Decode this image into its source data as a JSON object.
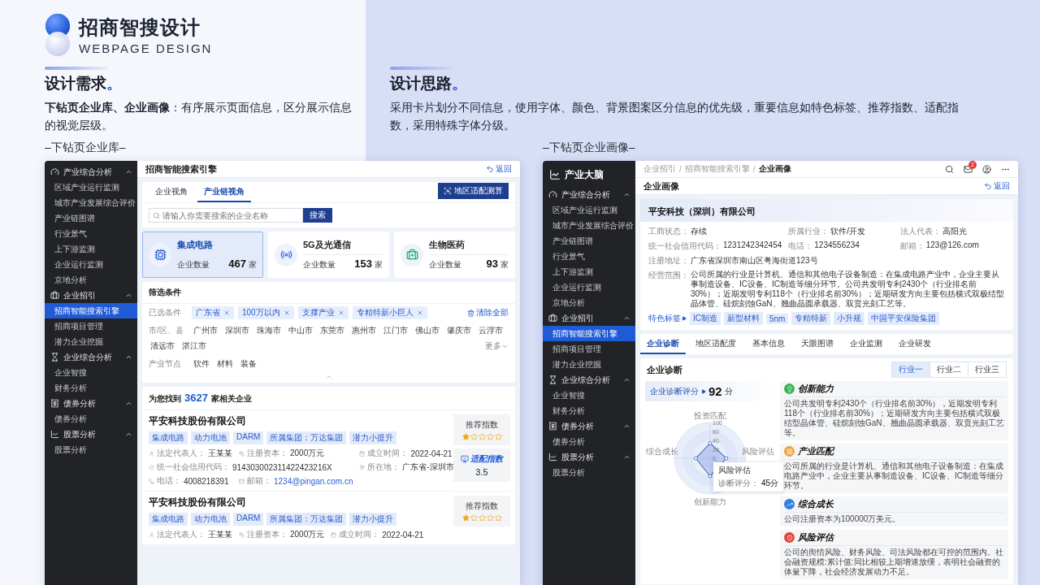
{
  "brand": {
    "title": "招商智搜设计",
    "subtitle": "WEBPAGE DESIGN"
  },
  "sections": [
    {
      "title": "设计需求",
      "dot": "。",
      "text": "**下钻页企业库、企业画像**：有序展示页面信息，区分展示信息的视觉层级。"
    },
    {
      "title": "设计思路",
      "dot": "。",
      "text": "采用卡片划分不同信息，使用字体、颜色、背景图案区分信息的优先级，重要信息如特色标签、推荐指数、适配指数，采用特殊字体分级。"
    }
  ],
  "library": {
    "caption": "–下钻页企业库–",
    "nav": [
      {
        "label": "产业综合分析",
        "expanded": true,
        "children": [
          {
            "label": "区域产业运行监测",
            "selected": false
          },
          {
            "label": "城市产业发展综合评价",
            "selected": false
          },
          {
            "label": "产业链图谱",
            "selected": false
          },
          {
            "label": "行业景气",
            "selected": false
          },
          {
            "label": "上下游监测",
            "selected": false
          },
          {
            "label": "企业运行监测",
            "selected": false
          },
          {
            "label": "京地分析",
            "selected": false
          }
        ]
      },
      {
        "label": "企业招引",
        "expanded": true,
        "children": [
          {
            "label": "招商智能搜索引擎",
            "selected": true
          },
          {
            "label": "招商项目管理",
            "selected": false
          },
          {
            "label": "潜力企业挖掘",
            "selected": false
          }
        ]
      },
      {
        "label": "企业综合分析",
        "expanded": true,
        "children": [
          {
            "label": "企业智搜",
            "selected": false
          },
          {
            "label": "财务分析",
            "selected": false
          }
        ]
      },
      {
        "label": "债券分析",
        "expanded": true,
        "children": [
          {
            "label": "债券分析",
            "selected": false
          }
        ]
      },
      {
        "label": "股票分析",
        "expanded": true,
        "children": [
          {
            "label": "股票分析",
            "selected": false
          }
        ]
      }
    ],
    "title": "招商智能搜索引擎",
    "back": "返回",
    "tabs": [
      {
        "label": "企业视角",
        "selected": false
      },
      {
        "label": "产业链视角",
        "selected": true
      }
    ],
    "action": "地区适配测算",
    "search": {
      "placeholder": "请输入你需要搜索的企业名称",
      "button": "搜索"
    },
    "industries": [
      {
        "name": "集成电路",
        "count_label": "企业数量",
        "count": "467",
        "unit": "家",
        "selected": true
      },
      {
        "name": "5G及光通信",
        "count_label": "企业数量",
        "count": "153",
        "unit": "家",
        "selected": false
      },
      {
        "name": "生物医药",
        "count_label": "企业数量",
        "count": "93",
        "unit": "家",
        "selected": false
      }
    ],
    "filter": {
      "title": "筛选条件",
      "selected_label": "已选条件",
      "chips": [
        "广东省",
        "100万以内",
        "支撑产业",
        "专精特新小巨人"
      ],
      "clear": "清除全部",
      "rows": [
        {
          "label": "市/区、县",
          "options": [
            "广州市",
            "深圳市",
            "珠海市",
            "中山市",
            "东莞市",
            "惠州市",
            "江门市",
            "佛山市",
            "肇庆市",
            "云浮市",
            "清远市",
            "湛江市"
          ],
          "more": "更多"
        },
        {
          "label": "产业节点",
          "options": [
            "软件",
            "材料",
            "装备"
          ]
        }
      ]
    },
    "results": {
      "prefix": "为您找到",
      "count": "3627",
      "suffix": "家相关企业"
    },
    "companies": [
      {
        "name": "平安科技股份有限公司",
        "tags": [
          "集成电路",
          "动力电池",
          "DARM",
          "所属集团：万达集团",
          "潜力小提升"
        ],
        "fields": [
          {
            "label": "法定代表人：",
            "value": "王某某",
            "kind": "text"
          },
          {
            "label": "注册资本：",
            "value": "2000万元",
            "kind": "text"
          },
          {
            "label": "成立时间：",
            "value": "2022-04-21",
            "kind": "text"
          },
          {
            "label": "统一社会信用代码：",
            "value": "914303002311422423216X",
            "kind": "text"
          },
          {
            "label": "所在地：",
            "value": "广东省-深圳市",
            "kind": "text"
          },
          {
            "label": "电话：",
            "value": "4008218391",
            "kind": "text"
          },
          {
            "label": "邮箱：",
            "value": "1234@pingan.com.cn",
            "kind": "link"
          }
        ],
        "recommend": {
          "label": "推荐指数",
          "stars": 1
        },
        "fit": {
          "label": "适配指数",
          "value": "3.5"
        }
      },
      {
        "name": "平安科技股份有限公司",
        "tags": [
          "集成电路",
          "动力电池",
          "DARM",
          "所属集团：万达集团",
          "潜力小提升"
        ],
        "fields": [
          {
            "label": "法定代表人：",
            "value": "王某某",
            "kind": "text"
          },
          {
            "label": "注册资本：",
            "value": "2000万元",
            "kind": "text"
          },
          {
            "label": "成立时间：",
            "value": "2022-04-21",
            "kind": "text"
          }
        ],
        "recommend": {
          "label": "推荐指数",
          "stars": 1
        }
      }
    ]
  },
  "profile": {
    "caption": "–下钻页企业画像–",
    "brand": "产业大脑",
    "nav": [
      {
        "label": "产业综合分析",
        "expanded": true,
        "children": [
          {
            "label": "区域产业运行监测",
            "selected": false
          },
          {
            "label": "城市产业发展综合评价",
            "selected": false
          },
          {
            "label": "产业链图谱",
            "selected": false
          },
          {
            "label": "行业景气",
            "selected": false
          },
          {
            "label": "上下游监测",
            "selected": false
          },
          {
            "label": "企业运行监测",
            "selected": false
          },
          {
            "label": "京地分析",
            "selected": false
          }
        ]
      },
      {
        "label": "企业招引",
        "expanded": true,
        "children": [
          {
            "label": "招商智能搜索引擎",
            "selected": true
          },
          {
            "label": "招商项目管理",
            "selected": false
          },
          {
            "label": "潜力企业挖掘",
            "selected": false
          }
        ]
      },
      {
        "label": "企业综合分析",
        "expanded": true,
        "children": [
          {
            "label": "企业智搜",
            "selected": false
          },
          {
            "label": "财务分析",
            "selected": false
          }
        ]
      },
      {
        "label": "债券分析",
        "expanded": true,
        "children": [
          {
            "label": "债券分析",
            "selected": false
          }
        ]
      },
      {
        "label": "股票分析",
        "expanded": true,
        "children": [
          {
            "label": "股票分析",
            "selected": false
          }
        ]
      }
    ],
    "breadcrumb": [
      {
        "label": "企业招引",
        "selected": false
      },
      {
        "label": "招商智能搜索引擎",
        "selected": false
      },
      {
        "label": "企业画像",
        "selected": true
      }
    ],
    "separator": "/",
    "notifications": "2",
    "title": "企业画像",
    "back": "返回",
    "company": {
      "name": "平安科技（深圳）有限公司",
      "fields": [
        {
          "label": "工商状态：",
          "value": "存续"
        },
        {
          "label": "所属行业：",
          "value": "软件/开发"
        },
        {
          "label": "法人代表：",
          "value": "高阳光"
        },
        {
          "label": "统一社会信用代码：",
          "value": "1231242342454"
        },
        {
          "label": "电话：",
          "value": "1234556234"
        },
        {
          "label": "邮箱：",
          "value": "123@126.com"
        }
      ],
      "address": {
        "label": "注册地址：",
        "value": "广东省深圳市南山区粤海街道123号"
      },
      "scope": {
        "label": "经营范围：",
        "value": "公司所属的行业是计算机、通信和其他电子设备制造：在集成电路产业中，企业主要从事制造设备、IC设备、IC制造等细分环节。公司共发明专利2430个（行业排名前30%）；近期发明专利118个（行业排名前30%）；近期研发方向主要包括横式双极结型晶体管、硅烷刻蚀GaN、翘曲晶圆承载器、双贲光刻工艺等。"
      },
      "tags_label": "特色标签",
      "tags": [
        "IC制造",
        "新型材料",
        "5nm",
        "专精特新",
        "小升规",
        "中国平安保险集团"
      ]
    },
    "tabs": [
      {
        "label": "企业诊断",
        "selected": true
      },
      {
        "label": "地区适配度",
        "selected": false
      },
      {
        "label": "基本信息",
        "selected": false
      },
      {
        "label": "天眼图谱",
        "selected": false
      },
      {
        "label": "企业监测",
        "selected": false
      },
      {
        "label": "企业研发",
        "selected": false
      }
    ],
    "diagnosis": {
      "title": "企业诊断",
      "segments": [
        {
          "label": "行业一",
          "selected": true
        },
        {
          "label": "行业二",
          "selected": false
        },
        {
          "label": "行业三",
          "selected": false
        }
      ],
      "score_label": "企业诊断评分",
      "score": "92",
      "score_unit": "分",
      "radar": {
        "axes": [
          "投资匹配",
          "风险评估",
          "创新能力",
          "综合成长"
        ],
        "ticks": [
          "100",
          "60",
          "40",
          "20",
          "0"
        ],
        "tooltip": {
          "title": "风险评估",
          "label": "诊断评分：",
          "value": "45分"
        }
      },
      "insights": [
        {
          "title": "创新能力",
          "color": "#3fb35a",
          "text": "公司共发明专利2430个（行业排名前30%），近期发明专利118个（行业排名前30%）；近期研发方向主要包括横式双极结型晶体管、硅烷刻蚀GaN、翘曲晶圆承载器、双贲光刻工艺等。"
        },
        {
          "title": "产业匹配",
          "color": "#f0a23a",
          "text": "公司所属的行业是计算机、通信和其他电子设备制造：在集成电路产业中，企业主要从事制造设备、IC设备、IC制造等细分环节。"
        },
        {
          "title": "综合成长",
          "color": "#2f7de1",
          "text": "公司注册资本为100000万美元。"
        },
        {
          "title": "风险评估",
          "color": "#e0443c",
          "text": "公司的舆情风险、财务风险、司法风险都在可控的范围内。社会融资规模:累计值:同比相较上期增速放缓，表明社会融资的体量下降，社会经济发展动力不足。"
        }
      ]
    }
  }
}
